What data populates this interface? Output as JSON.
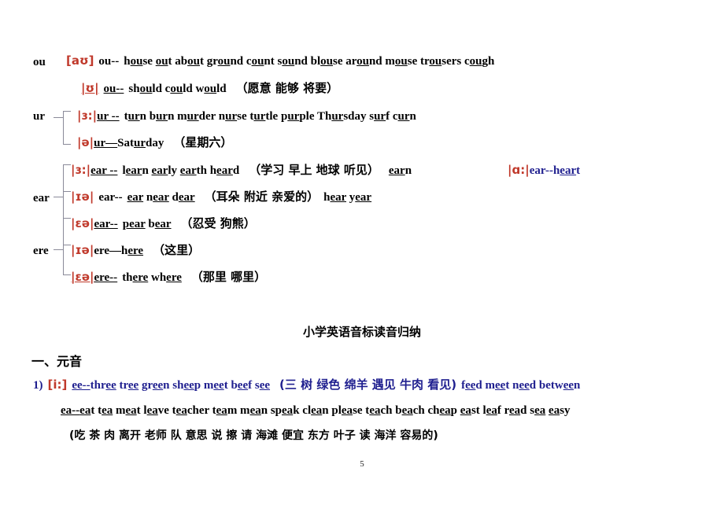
{
  "page": {
    "number": "5",
    "colors": {
      "phonetic_red": "#c0392b",
      "blue_text": "#1f1f8f",
      "bracket_gray": "#8a8a99",
      "body_black": "#000000"
    }
  },
  "groups": [
    {
      "label": "ou",
      "rows": [
        {
          "phonetic": "[aʊ]",
          "lead": "ou--",
          "words": "h<u>ou</u>se   <u>ou</u>t   ab<u>ou</u>t   gr<u>ou</u>nd   c<u>ou</u>nt   s<u>ou</u>nd   bl<u>ou</u>se   ar<u>ou</u>nd   m<u>ou</u>se tr<u>ou</u>sers   c<u>ou</u>gh",
          "words_plain": "house out about ground count sound blouse around mouse trousers cough",
          "gloss": ""
        },
        {
          "phonetic": "|ʊ|",
          "lead": "ou--",
          "words": "sh<u>ou</u>ld    c<u>ou</u>ld    w<u>ou</u>ld",
          "words_plain": "should could would",
          "gloss": "（愿意 能够 将要）"
        }
      ]
    },
    {
      "label": "ur",
      "rows": [
        {
          "phonetic": "|ɜ:|",
          "lead": "ur --",
          "words": "t<u>ur</u>n    b<u>ur</u>n    m<u>ur</u>der    n<u>ur</u>se    t<u>ur</u>tle    p<u>ur</u>ple    Th<u>ur</u>sday    s<u>ur</u>f    c<u>ur</u>n",
          "words_plain": "turn burn murder nurse turtle purple Thursday surf curn",
          "gloss": ""
        },
        {
          "phonetic": "|ə|",
          "lead": "ur—",
          "words": "Sat<u>ur</u>day",
          "words_plain": "Saturday",
          "gloss": "（星期六）"
        }
      ]
    },
    {
      "label": "ear",
      "rows": [
        {
          "phonetic": "|ɜ:|",
          "lead": "ear --",
          "words": "l<u>ear</u>n     <u>ear</u>ly   <u>ear</u>th   h<u>ear</u>d",
          "words_plain": "learn early earth heard",
          "gloss": "（学习 早上 地球 听见）",
          "tail": "<u>ear</u>n",
          "tail_plain": "earn",
          "extra": {
            "phonetic": "|ɑ:|",
            "text": "ear--h<u>ear</u>t",
            "text_plain": "ear--heart",
            "color": "#1f1f8f"
          }
        },
        {
          "phonetic": "|ɪə|",
          "lead": "ear--",
          "words": "<u>ear</u>     n<u>ear</u>   d<u>ear</u>",
          "words_plain": "ear near dear",
          "gloss": "（耳朵 附近 亲爱的）",
          "tail": "h<u>ear</u> y<u>ear</u>",
          "tail_plain": "hear year"
        },
        {
          "phonetic": "|ɛə|",
          "lead": "ear--",
          "words": "<u>pear</u>    b<u>ear</u>",
          "words_plain": "pear bear",
          "gloss": "（忍受 狗熊）"
        }
      ]
    },
    {
      "label": "ere",
      "rows": [
        {
          "phonetic": "|ɪə|",
          "lead": "ere—",
          "words": "h<u>ere</u>",
          "words_plain": "here",
          "gloss": "（这里）"
        },
        {
          "phonetic": "|ɛə|",
          "lead": "ere--",
          "words": "th<u>ere</u>    wh<u>ere</u>",
          "words_plain": "there where",
          "gloss": "（那里 哪里）"
        }
      ]
    }
  ],
  "title": "小学英语音标读音归纳",
  "section": "一、元音",
  "vowel_entry": {
    "index": "1)",
    "phonetic": "[i:]",
    "line1_lead": "ee--",
    "line1_words": "thr<u>ee</u>    tr<u>ee</u>    gr<u>ee</u>n    sh<u>ee</u>p    m<u>ee</u>t    b<u>ee</u>f    s<u>ee</u>",
    "line1_words_plain": "three tree green sheep meet beef see",
    "line1_gloss": "(三 树 绿色 绵羊 遇见 牛肉 看见)",
    "line1_tail": "f<u>ee</u>d    m<u>ee</u>t    n<u>ee</u>d    betw<u>ee</u>n",
    "line1_tail_plain": "feed meet need between",
    "line2_lead": "ea--",
    "line2_words": "<u>ea</u>t    t<u>ea</u>    m<u>ea</u>t    l<u>ea</u>ve    t<u>ea</u>cher    t<u>ea</u>m    m<u>ea</u>n sp<u>ea</u>k    cl<u>ea</u>n pl<u>ea</u>se    t<u>ea</u>ch b<u>ea</u>ch    ch<u>ea</u>p <u>ea</u>st    l<u>ea</u>f    r<u>ea</u>d s<u>ea</u> <u>ea</u>sy",
    "line2_words_plain": "eat tea meat leave teacher team mean speak clean please teach beach cheap east leaf read sea easy",
    "line3_gloss": "(吃  茶   肉   离开    老师    队   意思   说     擦    请  海滩  便宜   东方 叶子  读  海洋 容易的)"
  }
}
